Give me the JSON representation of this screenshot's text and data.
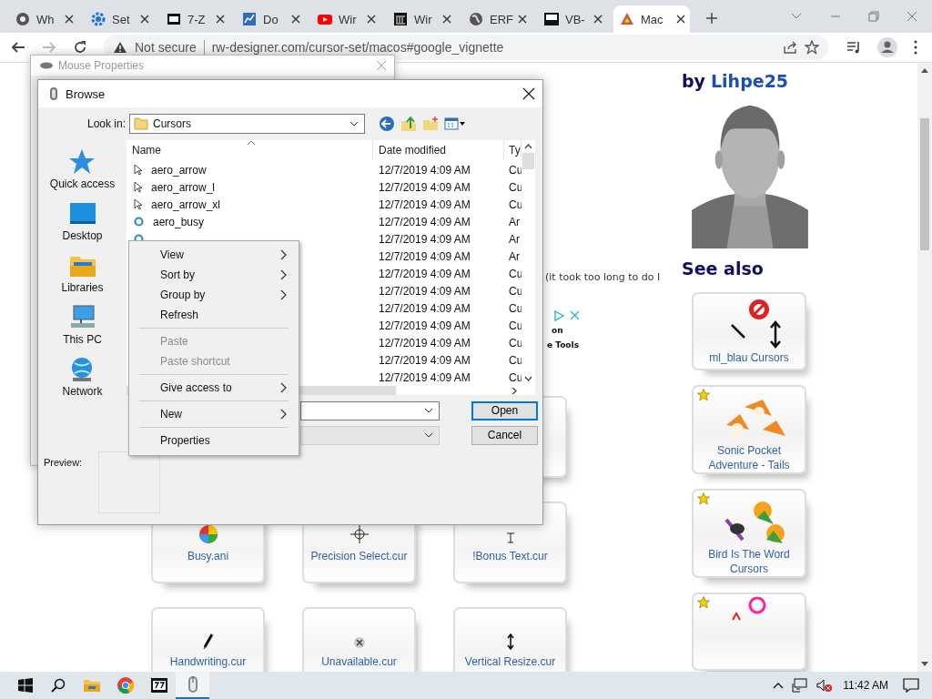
{
  "browser": {
    "tabs": [
      {
        "title": "Wh",
        "selected": false
      },
      {
        "title": "Set",
        "selected": false
      },
      {
        "title": "7-Z",
        "selected": false
      },
      {
        "title": "Do",
        "selected": false
      },
      {
        "title": "Wir",
        "selected": false
      },
      {
        "title": "Wir",
        "selected": false
      },
      {
        "title": "ERF",
        "selected": false
      },
      {
        "title": "VB-",
        "selected": false
      },
      {
        "title": "Mac",
        "selected": true
      }
    ],
    "address_bar": {
      "security": "Not secure",
      "url": "rw-designer.com/cursor-set/macos#google_vignette"
    }
  },
  "page": {
    "snippet": "(it took too long to do I",
    "ad": {
      "line_1": "on",
      "line_2": "e Tools"
    },
    "cursor_cards": [
      {
        "kind": "blank"
      },
      {
        "kind": "cursor",
        "caption": "Busy.ani"
      },
      {
        "kind": "cursor",
        "caption": "Precision Select.cur"
      },
      {
        "kind": "cursor",
        "caption": "!Bonus Text.cur"
      },
      {
        "kind": "cursor",
        "caption": "Handwriting.cur"
      },
      {
        "kind": "cursor",
        "caption": "Unavailable.cur"
      },
      {
        "kind": "cursor",
        "caption": "Vertical Resize.cur"
      }
    ],
    "sidebar": {
      "byline": "by",
      "author": "Lihpe25",
      "see_also": "See also",
      "sets": [
        {
          "title": "ml_blau Cursors",
          "featured": false
        },
        {
          "title": "Sonic Pocket Adventure - Tails",
          "featured": true
        },
        {
          "title": "Bird Is The Word Cursors",
          "featured": true
        },
        {
          "featured": true
        }
      ]
    }
  },
  "mouse_properties": {
    "title": "Mouse Properties"
  },
  "browse_dialog": {
    "title": "Browse",
    "look_in_label": "Look in:",
    "look_in_value": "Cursors",
    "places": [
      "Quick access",
      "Desktop",
      "Libraries",
      "This PC",
      "Network"
    ],
    "columns": [
      "Name",
      "Date modified",
      "Ty"
    ],
    "files": [
      {
        "kind": "arrow",
        "name": "aero_arrow",
        "date": "12/7/2019 4:09 AM",
        "type": "Cu"
      },
      {
        "kind": "arrow",
        "name": "aero_arrow_l",
        "date": "12/7/2019 4:09 AM",
        "type": "Cu"
      },
      {
        "kind": "arrow",
        "name": "aero_arrow_xl",
        "date": "12/7/2019 4:09 AM",
        "type": "Cu"
      },
      {
        "kind": "busy",
        "name": "aero_busy",
        "date": "12/7/2019 4:09 AM",
        "type": "Ar"
      },
      {
        "kind": "busy",
        "date": "12/7/2019 4:09 AM",
        "type": "Ar"
      },
      {
        "date": "12/7/2019 4:09 AM",
        "type": "Ar"
      },
      {
        "date": "12/7/2019 4:09 AM",
        "type": "Cu"
      },
      {
        "date": "12/7/2019 4:09 AM",
        "type": "Cu"
      },
      {
        "date": "12/7/2019 4:09 AM",
        "type": "Cu"
      },
      {
        "date": "12/7/2019 4:09 AM",
        "type": "Cu"
      },
      {
        "date": "12/7/2019 4:09 AM",
        "type": "Cu"
      },
      {
        "date": "12/7/2019 4:09 AM",
        "type": "Cu"
      },
      {
        "date": "12/7/2019 4:09 AM",
        "type": "Cu"
      }
    ],
    "open_button": "Open",
    "cancel_button": "Cancel",
    "preview_label": "Preview:"
  },
  "context_menu": {
    "items": [
      {
        "kind": "submenu",
        "label": "View",
        "disabled": false
      },
      {
        "kind": "submenu",
        "label": "Sort by",
        "disabled": false
      },
      {
        "kind": "submenu",
        "label": "Group by",
        "disabled": false
      },
      {
        "kind": "item",
        "label": "Refresh",
        "disabled": false
      },
      {
        "kind": "separator"
      },
      {
        "kind": "item",
        "label": "Paste",
        "disabled": true
      },
      {
        "kind": "item",
        "label": "Paste shortcut",
        "disabled": true
      },
      {
        "kind": "separator"
      },
      {
        "kind": "submenu",
        "label": "Give access to",
        "disabled": false
      },
      {
        "kind": "separator"
      },
      {
        "kind": "submenu",
        "label": "New",
        "disabled": false
      },
      {
        "kind": "separator"
      },
      {
        "kind": "item",
        "label": "Properties",
        "disabled": false
      }
    ]
  },
  "taskbar": {
    "apps": [
      {
        "selected": false
      },
      {
        "selected": false
      },
      {
        "selected": false
      },
      {
        "selected": true
      }
    ],
    "clock": "11:42 AM"
  }
}
